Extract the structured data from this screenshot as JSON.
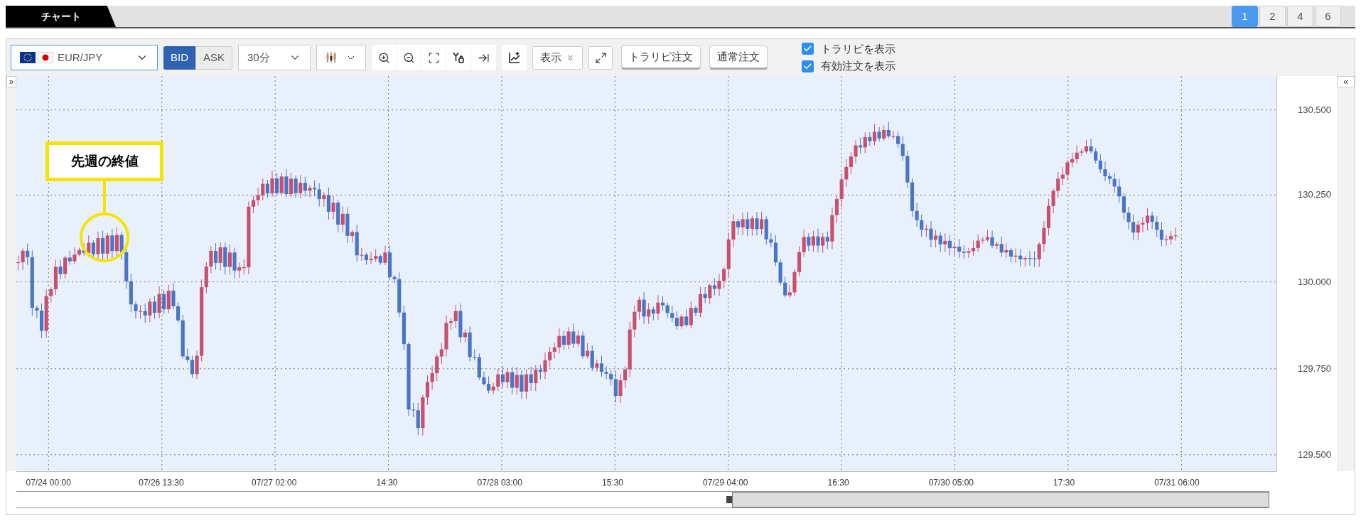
{
  "tabs": [
    {
      "label": "チャート",
      "selected": true
    }
  ],
  "layout_buttons": [
    {
      "label": "1",
      "selected": true
    },
    {
      "label": "2",
      "selected": false
    },
    {
      "label": "4",
      "selected": false
    },
    {
      "label": "6",
      "selected": false
    }
  ],
  "toolbar": {
    "symbol": "EUR/JPY",
    "price_side": [
      {
        "label": "BID",
        "selected": true
      },
      {
        "label": "ASK",
        "selected": false
      }
    ],
    "timeframe": "30分",
    "display_menu": "表示",
    "order_buttons": [
      "トラリピ注文",
      "通常注文"
    ],
    "checkboxes": [
      {
        "label": "トラリピを表示",
        "checked": true
      },
      {
        "label": "有効注文を表示",
        "checked": true
      }
    ]
  },
  "chart": {
    "annotation": "先週の終値",
    "collapse_left": "»",
    "collapse_right": "«",
    "y_axis_labels": [
      "130.500",
      "130.250",
      "130.000",
      "129.750",
      "129.500"
    ],
    "x_axis_labels": [
      "07/24 00:00",
      "07/26 13:30",
      "07/27 02:00",
      "14:30",
      "07/28 03:00",
      "15:30",
      "07/29 04:00",
      "16:30",
      "07/30 05:00",
      "17:30",
      "07/31 06:00"
    ]
  }
}
